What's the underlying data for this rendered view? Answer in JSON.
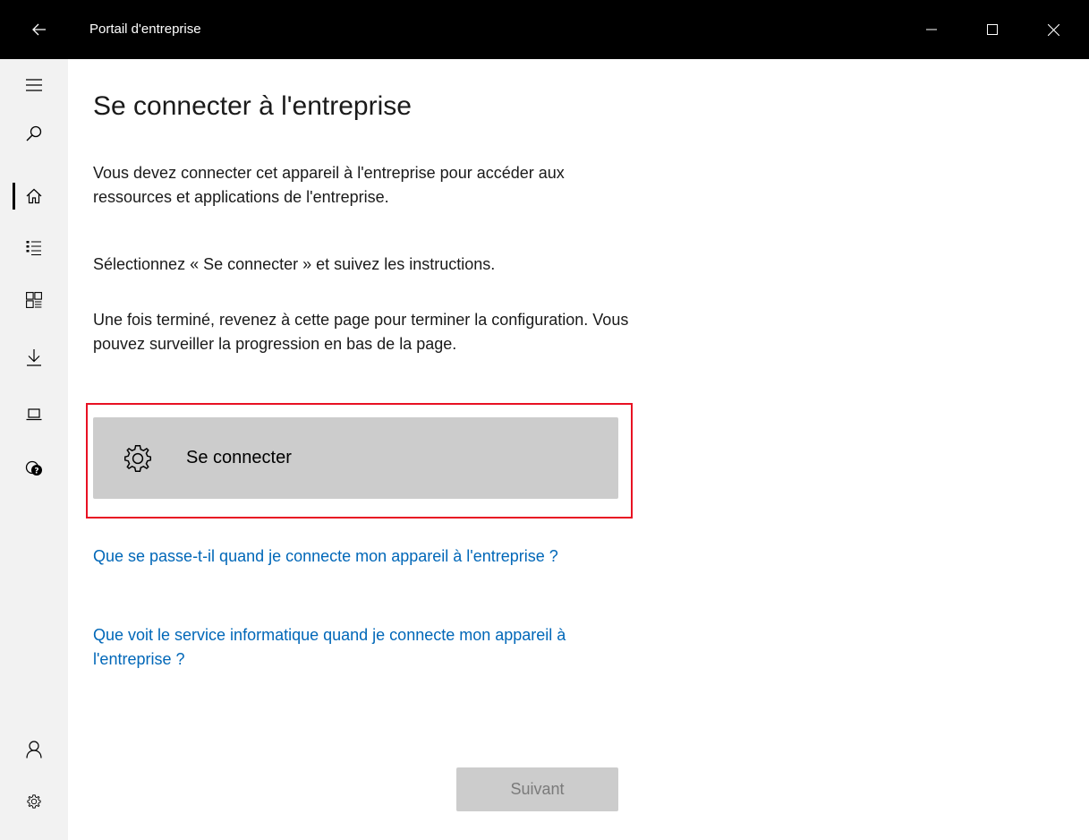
{
  "window": {
    "title": "Portail d'entreprise",
    "back_icon": "back-arrow-icon",
    "minimize_icon": "minimize-icon",
    "maximize_icon": "maximize-icon",
    "close_icon": "close-icon"
  },
  "sidebar": {
    "items": [
      {
        "icon": "hamburger-menu-icon"
      },
      {
        "icon": "search-icon"
      },
      {
        "icon": "home-icon",
        "active": true
      },
      {
        "icon": "list-icon"
      },
      {
        "icon": "apps-grid-icon"
      },
      {
        "icon": "download-icon"
      },
      {
        "icon": "laptop-icon"
      },
      {
        "icon": "help-chat-icon"
      },
      {
        "icon": "account-icon"
      },
      {
        "icon": "settings-gear-icon"
      }
    ]
  },
  "main": {
    "title": "Se connecter à l'entreprise",
    "paragraph1": "Vous devez connecter cet appareil à l'entreprise pour accéder aux ressources et applications de l'entreprise.",
    "paragraph2": "Sélectionnez « Se connecter » et suivez les instructions.",
    "paragraph3": "Une fois terminé, revenez à cette page pour terminer la configuration. Vous pouvez surveiller la progression en bas de la page.",
    "connect_button": {
      "label": "Se connecter",
      "icon": "gear-icon"
    },
    "link1": "Que se passe-t-il quand je connecte mon appareil à l'entreprise ?",
    "link2": "Que voit le service informatique quand je connecte mon appareil à l'entreprise ?",
    "next_button": "Suivant"
  },
  "colors": {
    "titlebar": "#000000",
    "sidebar": "#f2f2f2",
    "highlight_border": "#e81123",
    "link": "#0067b8",
    "button_bg": "#cccccc"
  }
}
